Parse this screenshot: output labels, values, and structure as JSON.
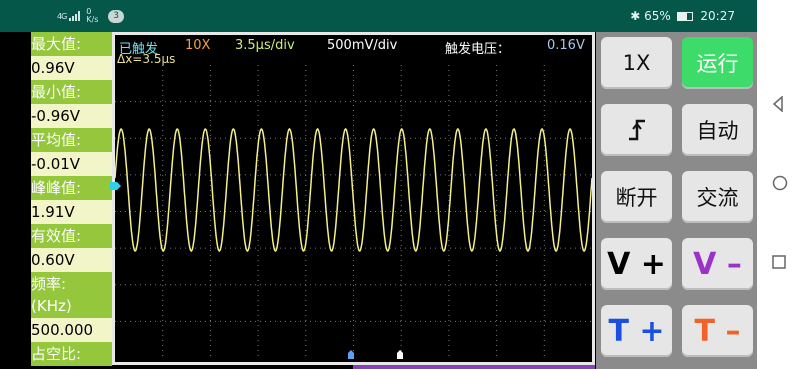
{
  "status": {
    "network": "4G",
    "speed": "0 K/s",
    "notifications": "3",
    "battery": "65%",
    "time": "20:27"
  },
  "measurements": {
    "max_label": "最大值:",
    "max_value": "0.96V",
    "min_label": "最小值:",
    "min_value": "-0.96V",
    "avg_label": "平均值:",
    "avg_value": "-0.01V",
    "pp_label": "峰峰值:",
    "pp_value": "1.91V",
    "rms_label": "有效值:",
    "rms_value": "0.60V",
    "freq_label": "频率:",
    "freq_unit": "(KHz)",
    "freq_value": "500.000",
    "duty_label": "占空比:"
  },
  "scope": {
    "trigger_status": "已触发",
    "probe": "10X",
    "timebase": "3.5μs/div",
    "voltdiv": "500mV/div",
    "trigger_label": "触发电压：",
    "trigger_value": "0.16V",
    "delta_x": "Δx=3.5μs",
    "waveform_color": "#f5f08a",
    "cycles": 17
  },
  "buttons": {
    "probe": "1X",
    "run": "运行",
    "edge_icon": "rising-edge-icon",
    "auto": "自动",
    "disconnect": "断开",
    "coupling": "交流",
    "v_plus": "V +",
    "v_minus": "V –",
    "t_plus": "T +",
    "t_minus": "T –"
  },
  "colors": {
    "label_bg": "#94c73b",
    "value_bg": "#f1f5c8",
    "run_green": "#3ddc6a",
    "v_minus": "#9b33c9",
    "t_plus": "#1a4fe0",
    "t_minus": "#f0622a",
    "trigger_marker": "#30d0e8"
  }
}
